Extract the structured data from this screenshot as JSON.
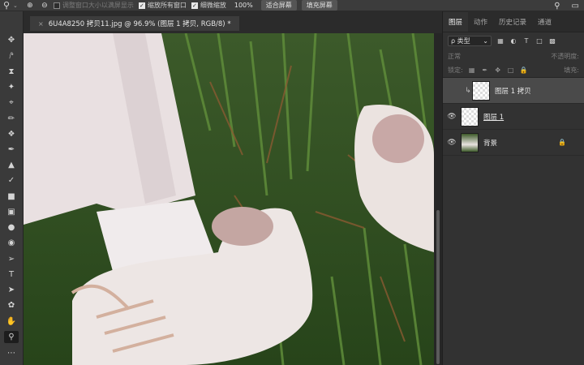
{
  "options_bar": {
    "tool_icon": "zoom-icon",
    "checkbox_resize": "调整窗口大小以满屏显示",
    "checkbox_zoom_all": "缩放所有窗口",
    "checkbox_scrubby": "细微缩放",
    "zoom_percent": "100%",
    "fit_screen": "适合屏幕",
    "fill_screen": "填充屏幕"
  },
  "document": {
    "tab_title": "6U4A8250 拷贝11.jpg @ 96.9% (图层 1 拷贝, RGB/8) *",
    "close": "×"
  },
  "panel": {
    "tabs": [
      "图层",
      "动作",
      "历史记录",
      "通道"
    ],
    "filter_type": "ρ 类型",
    "blend_mode": "正常",
    "opacity_label": "不透明度:",
    "lock_label": "锁定:",
    "fill_label": "填充:",
    "layers": [
      {
        "name": "图层 1 拷贝",
        "visible": false,
        "selected": true
      },
      {
        "name": "图层 1",
        "visible": true,
        "selected": false
      },
      {
        "name": "背景",
        "visible": true,
        "selected": false,
        "locked": true
      }
    ]
  },
  "colors": {
    "app_bg": "#282828",
    "panel_bg": "#323232",
    "selected_layer": "#4a4a4a"
  }
}
